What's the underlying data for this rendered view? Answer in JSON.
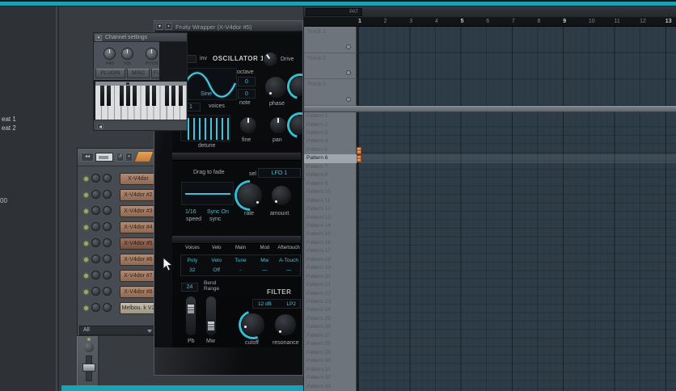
{
  "browser": {
    "items": [
      "eat 1",
      "eat 2"
    ],
    "footer": "00"
  },
  "channel_settings": {
    "title": "Channel settings",
    "knobs": [
      "PAN",
      "VOL",
      "PITCH"
    ],
    "tabs": [
      "PLUGIN",
      "MISC",
      "FUNC"
    ]
  },
  "channel_rack": {
    "channels": [
      {
        "name": "X-V4dor",
        "variant": "normal"
      },
      {
        "name": "X-V4dor #2",
        "variant": "normal"
      },
      {
        "name": "X-V4dor #3",
        "variant": "normal"
      },
      {
        "name": "X-V4dor #4",
        "variant": "normal"
      },
      {
        "name": "X-V4dor #5",
        "variant": "dark"
      },
      {
        "name": "X-V4dor #6",
        "variant": "normal"
      },
      {
        "name": "X-V4dor #7",
        "variant": "normal"
      },
      {
        "name": "X-V4dor #8",
        "variant": "normal"
      },
      {
        "name": "Melbou. k V2 !",
        "variant": "light"
      }
    ],
    "filter_label": "All"
  },
  "plugin": {
    "title": "Fruity Wrapper (X-V4dor #5)",
    "osc": {
      "inv": "inv",
      "section": "OSCILLATOR 1",
      "drive": "Drive",
      "wave": "Sine",
      "octave_label": "octave",
      "octave": "0",
      "note_label": "note",
      "note": "0",
      "voices": "1",
      "voices_label": "voices",
      "detune_label": "detune",
      "fine": "fine",
      "pan": "pan",
      "phase": "phase"
    },
    "lfo": {
      "drag": "Drag to fade",
      "sel": "sel",
      "target": "LFO 1",
      "speed": "1/16",
      "speed_label": "speed",
      "sync": "Sync On",
      "sync_label": "sync",
      "rate": "rate",
      "amount": "amount"
    },
    "matrix": {
      "cols": [
        {
          "h": "Voices",
          "a": "Poly",
          "b": "32"
        },
        {
          "h": "Velo",
          "a": "Velo",
          "b": "Off"
        },
        {
          "h": "Main",
          "a": "Tune",
          "b": "-"
        },
        {
          "h": "Mod",
          "a": "Mw",
          "b": "—"
        },
        {
          "h": "Aftertouch",
          "a": "A-Touch",
          "b": "—"
        }
      ]
    },
    "pitch": {
      "bend": "24",
      "bend_label": "Bend Range",
      "pb": "Pb",
      "mw": "Mw"
    },
    "filter": {
      "title": "FILTER",
      "slope": "12 dB",
      "mode": "LP2",
      "cutoff": "cutoff",
      "resonance": "resonance"
    }
  },
  "playlist": {
    "header_label": "PAT",
    "timeline": [
      "1",
      "2",
      "3",
      "4",
      "5",
      "6",
      "7",
      "8",
      "9",
      "10",
      "11",
      "12",
      "13"
    ],
    "tracks": [
      "Track 1",
      "Track 2",
      "Track 3"
    ],
    "patterns": [
      "Pattern 1",
      "Pattern 2",
      "Pattern 3",
      "Pattern 4",
      "Pattern 5",
      "Pattern 6",
      "Pattern 7",
      "Pattern 8",
      "Pattern 9",
      "Pattern 10",
      "Pattern 11",
      "Pattern 12",
      "Pattern 13",
      "Pattern 14",
      "Pattern 15",
      "Pattern 16",
      "Pattern 17",
      "Pattern 18",
      "Pattern 19",
      "Pattern 20",
      "Pattern 21",
      "Pattern 22",
      "Pattern 23",
      "Pattern 24",
      "Pattern 25",
      "Pattern 26",
      "Pattern 27",
      "Pattern 28",
      "Pattern 29",
      "Pattern 30",
      "Pattern 31",
      "Pattern 32",
      "Pattern 33"
    ],
    "selected_pattern": "Pattern 6"
  },
  "colors": {
    "accent_teal": "#1a9fb3",
    "clip_orange": "#cd7f4a",
    "grid_bg": "#2e3c47"
  }
}
